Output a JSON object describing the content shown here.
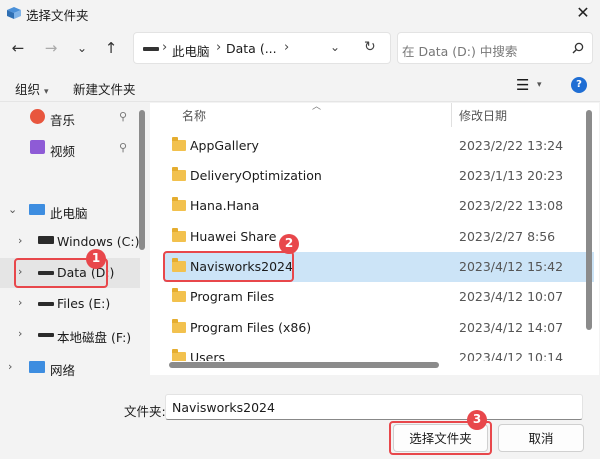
{
  "window": {
    "title": "选择文件夹"
  },
  "address": {
    "crumbs": [
      "此电脑",
      "Data (..."
    ],
    "search_placeholder": "在 Data (D:) 中搜索"
  },
  "toolbar": {
    "organize": "组织",
    "new_folder": "新建文件夹"
  },
  "nav": {
    "music": "音乐",
    "videos": "视频",
    "this_pc": "此电脑",
    "drive_c": "Windows (C:)",
    "drive_d": "Data (D:)",
    "drive_e": "Files (E:)",
    "drive_f": "本地磁盘 (F:)",
    "network": "网络"
  },
  "list": {
    "columns": [
      "名称",
      "修改日期"
    ],
    "rows": [
      {
        "name": "AppGallery",
        "date": "2023/2/22 13:24"
      },
      {
        "name": "DeliveryOptimization",
        "date": "2023/1/13 20:23"
      },
      {
        "name": "Hana.Hana",
        "date": "2023/2/22 13:08"
      },
      {
        "name": "Huawei Share",
        "date": "2023/2/27 8:56"
      },
      {
        "name": "Navisworks2024",
        "date": "2023/4/12 15:42",
        "selected": true
      },
      {
        "name": "Program Files",
        "date": "2023/4/12 10:07"
      },
      {
        "name": "Program Files (x86)",
        "date": "2023/4/12 14:07"
      },
      {
        "name": "Users",
        "date": "2023/4/12 10:14"
      }
    ]
  },
  "footer": {
    "folder_label": "文件夹:",
    "folder_value": "Navisworks2024",
    "select_button": "选择文件夹",
    "cancel_button": "取消"
  },
  "annotations": [
    "1",
    "2",
    "3"
  ],
  "colors": {
    "accent": "#1f6ed4",
    "selection": "#cce4f7",
    "annotation": "#e8474b",
    "folder": "#f2c14e"
  }
}
